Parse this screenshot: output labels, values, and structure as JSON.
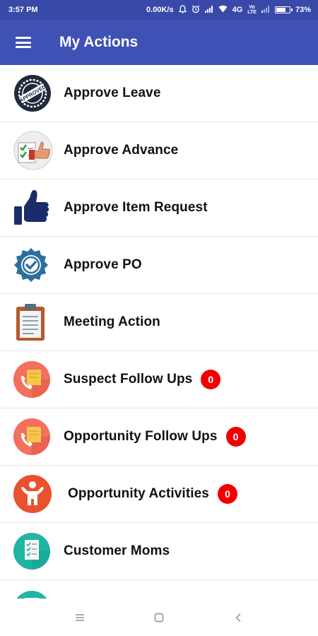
{
  "status_bar": {
    "time": "3:57 PM",
    "net_speed": "0.00K/s",
    "network_type": "4G",
    "volte_top": "Vo",
    "volte_bottom": "LTE",
    "battery": "73%",
    "battery_level": 0.73
  },
  "app_bar": {
    "title": "My Actions"
  },
  "actions": [
    {
      "label": "Approve Leave",
      "icon": "approved-stamp-icon"
    },
    {
      "label": "Approve Advance",
      "icon": "thumbs-up-check-icon"
    },
    {
      "label": "Approve Item Request",
      "icon": "thumbs-up-icon"
    },
    {
      "label": "Approve PO",
      "icon": "check-badge-icon"
    },
    {
      "label": "Meeting Action",
      "icon": "clipboard-icon"
    },
    {
      "label": "Suspect Follow Ups",
      "icon": "phone-note-icon",
      "badge": "0"
    },
    {
      "label": "Opportunity Follow Ups",
      "icon": "phone-note-icon",
      "badge": "0"
    },
    {
      "label": "Opportunity Activities",
      "icon": "person-activity-icon",
      "badge": "0"
    },
    {
      "label": "Customer Moms",
      "icon": "checklist-icon"
    },
    {
      "label": "",
      "icon": "teal-circle-icon"
    }
  ],
  "colors": {
    "status_bar": "#3949a8",
    "app_bar": "#3f51b5",
    "badge": "#f20000"
  },
  "stamp_text": "APPROVED"
}
